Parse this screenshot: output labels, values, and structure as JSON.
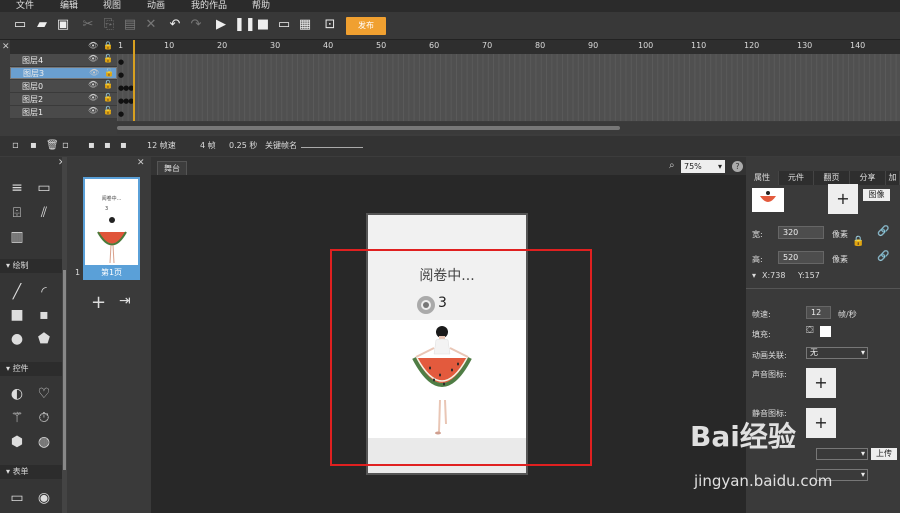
{
  "menu": [
    "文件",
    "编辑",
    "视图",
    "动画",
    "我的作品",
    "帮助"
  ],
  "toolbar": {
    "publish_label": "发布"
  },
  "timeline": {
    "ruler": [
      "1",
      "10",
      "20",
      "30",
      "40",
      "50",
      "60",
      "70",
      "80",
      "90",
      "100",
      "110",
      "120",
      "130",
      "140"
    ],
    "layers": [
      {
        "name": "图层4",
        "selected": false
      },
      {
        "name": "图层3",
        "selected": true
      },
      {
        "name": "图层0",
        "selected": false
      },
      {
        "name": "图层2",
        "selected": false
      },
      {
        "name": "图层1",
        "selected": false
      }
    ],
    "fps": "12 帧速",
    "frame": "4 帧",
    "time": "0.25 秒",
    "keyframe_label": "关键帧名"
  },
  "tools": {
    "sections": [
      "绘制",
      "控件",
      "表单"
    ]
  },
  "pages": {
    "thumb_label": "第1页",
    "index": "1",
    "thumb_text": "阅卷中...",
    "thumb_count": "3"
  },
  "stage": {
    "tab": "舞台",
    "zoom": "75%",
    "reading_text": "阅卷中...",
    "count": "3"
  },
  "panel": {
    "tabs": [
      "属性",
      "元件",
      "翻页",
      "分享",
      "加"
    ],
    "image_btn": "图像",
    "width_label": "宽:",
    "width_value": "320",
    "height_label": "高:",
    "height_value": "520",
    "px_unit": "像素",
    "x_label": "X:738",
    "y_label": "Y:157",
    "fps_label": "帧速:",
    "fps_value": "12",
    "fps_unit": "帧/秒",
    "fill_label": "填充:",
    "anim_label": "动画关联:",
    "anim_value": "无",
    "sound_icon_label": "声音图标:",
    "mute_icon_label": "静音图标:",
    "upload": "上传"
  },
  "watermark": {
    "brand": "Bai经验",
    "url": "jingyan.baidu.com"
  },
  "colors": {
    "accent": "#5aa0d8",
    "publish": "#f0a030",
    "highlight": "#e02020",
    "playhead": "#d8a020"
  }
}
